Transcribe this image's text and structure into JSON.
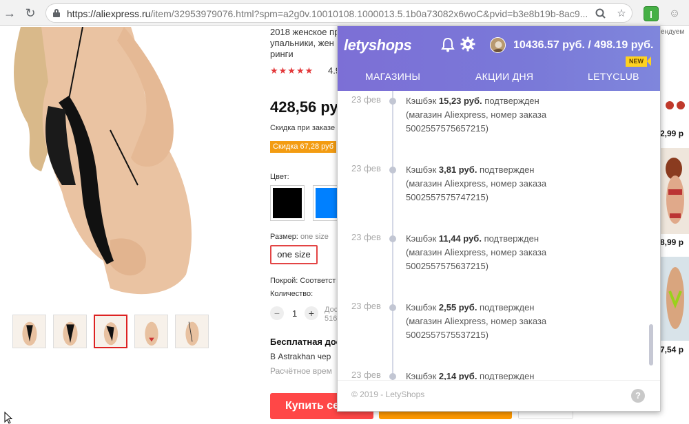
{
  "browser": {
    "url_host": "https://aliexpress.ru",
    "url_path": "/item/32953979076.html?spm=a2g0v.10010108.1000013.5.1b0a73082x6woC&pvid=b3e8b19b-8ac9..."
  },
  "product": {
    "title": "2018 женское пр упальники, жен ринги",
    "stars": "★★★★★",
    "rating": "4.9",
    "price": "428,56 ру",
    "discount_note": "Скидка при заказе",
    "discount_badge": "Скидка 67,28 руб",
    "color_label": "Цвет:",
    "size_label": "Размер:",
    "size_value": "one size",
    "size_chip": "one size",
    "fit_label": "Покрой: Соответст",
    "qty_label": "Количество:",
    "qty_minus": "−",
    "qty_plus": "+",
    "qty_value": "1",
    "avail_line1": "Дос",
    "avail_line2": "516",
    "shipping_title": "Бесплатная дос",
    "shipping_sub": "В Astrakhan чер",
    "shipping_est": "Расчётное врем",
    "buy_label": "Купить сей",
    "colors": [
      "#000000",
      "#0080ff"
    ]
  },
  "right_column": {
    "header": "ендуем",
    "prices": [
      "2,99 р",
      "8,99 р",
      "7,54 р"
    ]
  },
  "letyshops": {
    "logo": "letyshops",
    "balance": "10436.57 руб. / 498.19 руб.",
    "tabs": [
      "МАГАЗИНЫ",
      "АКЦИИ ДНЯ",
      "LETYCLUB"
    ],
    "new_badge": "NEW",
    "entries": [
      {
        "date": "23 фев",
        "prefix": "Кэшбэк ",
        "amount": "15,23 руб.",
        "suffix": " подтвержден",
        "line2": "(магазин Aliexpress, номер заказа",
        "line3": "5002557575657215)"
      },
      {
        "date": "23 фев",
        "prefix": "Кэшбэк ",
        "amount": "3,81 руб.",
        "suffix": " подтвержден",
        "line2": "(магазин Aliexpress, номер заказа",
        "line3": "5002557575747215)"
      },
      {
        "date": "23 фев",
        "prefix": "Кэшбэк ",
        "amount": "11,44 руб.",
        "suffix": " подтвержден",
        "line2": "(магазин Aliexpress, номер заказа",
        "line3": "5002557575637215)"
      },
      {
        "date": "23 фев",
        "prefix": "Кэшбэк ",
        "amount": "2,55 руб.",
        "suffix": " подтвержден",
        "line2": "(магазин Aliexpress, номер заказа",
        "line3": "5002557575537215)"
      },
      {
        "date": "23 фев",
        "prefix": "Кэшбэк ",
        "amount": "2,14 руб.",
        "suffix": " подтвержден",
        "line2": "",
        "line3": ""
      }
    ],
    "copyright": "© 2019 - LetyShops",
    "help": "?"
  }
}
